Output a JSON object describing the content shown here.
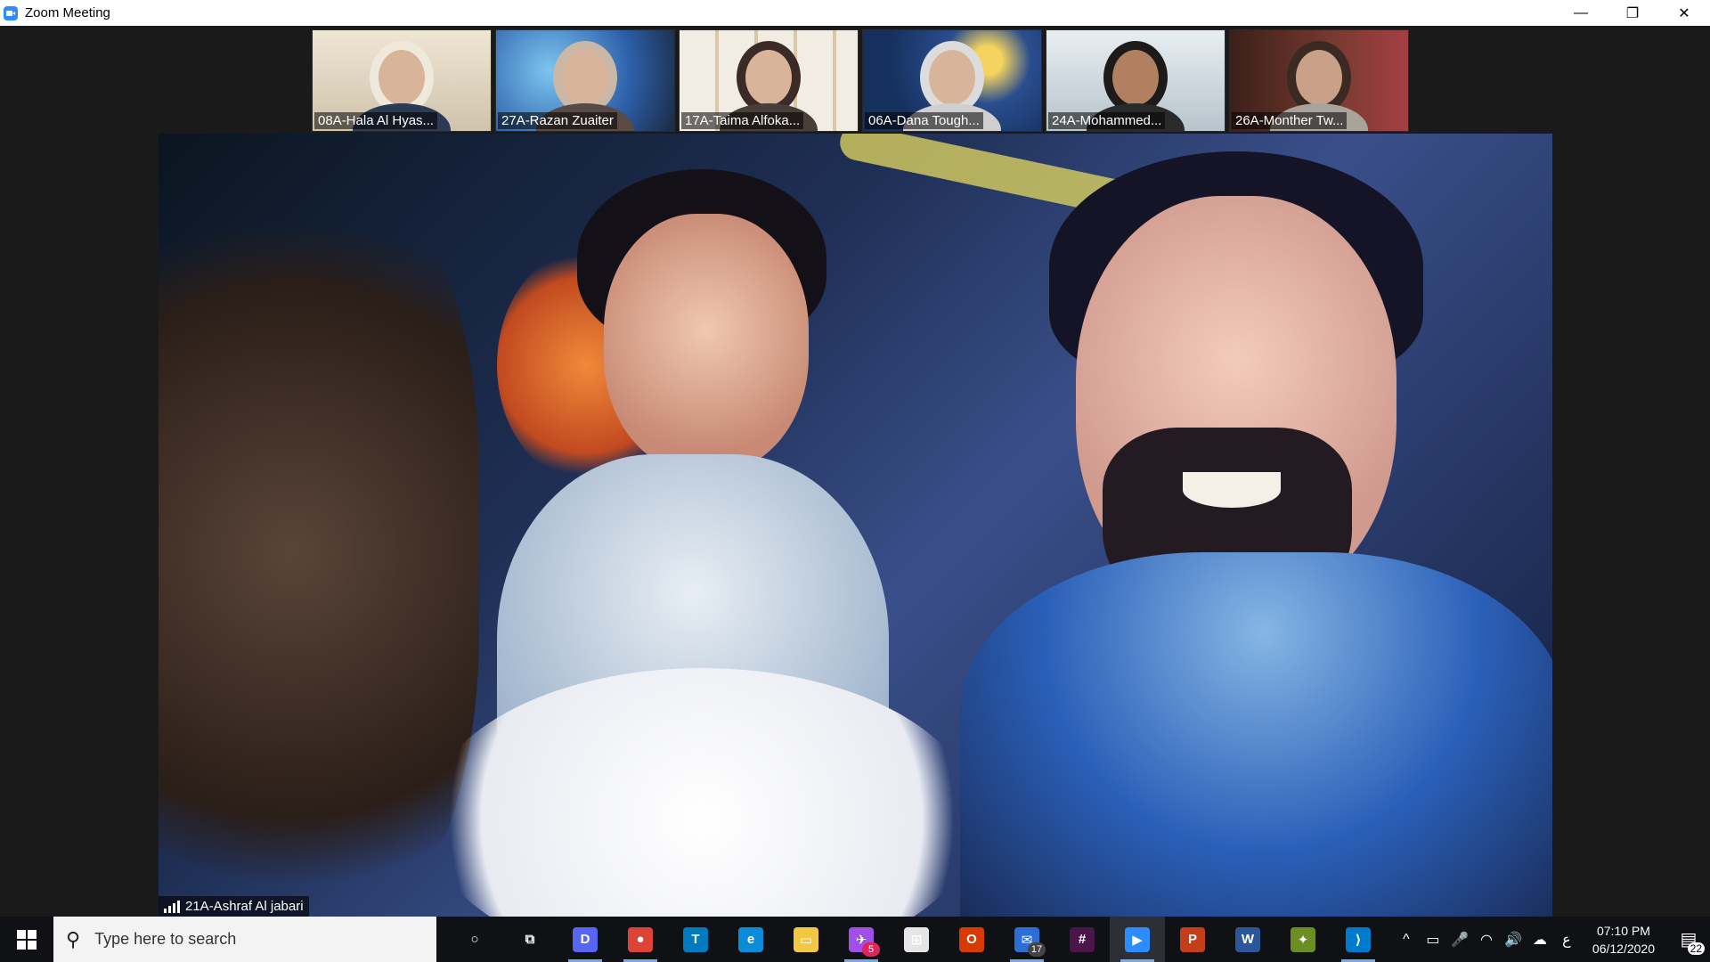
{
  "window": {
    "title": "Zoom Meeting",
    "minimize": "—",
    "restore": "❐",
    "close": "✕"
  },
  "participants": [
    {
      "name": "08A-Hala Al Hyas...",
      "bg": "#e7dcc8",
      "scarf": "#efe9dc",
      "body": "#2b3a55"
    },
    {
      "name": "27A-Razan Zuaiter",
      "bg": "#3d6fb8",
      "scarf": "#c9b8a6",
      "body": "#5a4a46"
    },
    {
      "name": "17A-Taima Alfoka...",
      "bg": "#f0ece2",
      "scarf": "#3b2a26",
      "body": "#4a3e3a"
    },
    {
      "name": "06A-Dana Tough...",
      "bg": "#21437c",
      "scarf": "#dcdcdc",
      "body": "#cfcfcf"
    },
    {
      "name": "24A-Mohammed...",
      "bg": "#dfe6ea",
      "scarf": "#1d1a1a",
      "body": "#2a2a2a"
    },
    {
      "name": "26A-Monther Tw...",
      "bg": "#4a2a22",
      "scarf": "#3a2a22",
      "body": "#a8a39b"
    }
  ],
  "active_speaker": {
    "name": "21A-Ashraf Al jabari"
  },
  "taskbar": {
    "search_placeholder": "Type here to search",
    "apps": [
      {
        "id": "cortana",
        "icon": "cortana-icon",
        "glyph": "○",
        "color": "transparent"
      },
      {
        "id": "task-view",
        "icon": "task-view-icon",
        "glyph": "⧉",
        "color": "transparent"
      },
      {
        "id": "discord",
        "icon": "discord-icon",
        "glyph": "D",
        "color": "#5865F2"
      },
      {
        "id": "chrome",
        "icon": "chrome-icon",
        "glyph": "●",
        "color": "#db4437"
      },
      {
        "id": "trello",
        "icon": "trello-icon",
        "glyph": "T",
        "color": "#0079BF"
      },
      {
        "id": "edge",
        "icon": "edge-icon",
        "glyph": "e",
        "color": "#0c8bd6"
      },
      {
        "id": "file-explorer",
        "icon": "folder-icon",
        "glyph": "▭",
        "color": "#f2c744"
      },
      {
        "id": "messenger",
        "icon": "messenger-icon",
        "glyph": "✈",
        "color": "#a050e8",
        "badge": "5"
      },
      {
        "id": "store",
        "icon": "store-icon",
        "glyph": "⊞",
        "color": "#e5e5e5"
      },
      {
        "id": "office",
        "icon": "office-icon",
        "glyph": "O",
        "color": "#d83b01"
      },
      {
        "id": "mail",
        "icon": "mail-icon",
        "glyph": "✉",
        "color": "#2b6fd6",
        "badge": "17"
      },
      {
        "id": "slack",
        "icon": "slack-icon",
        "glyph": "#",
        "color": "#4a154b"
      },
      {
        "id": "zoom",
        "icon": "zoom-icon",
        "glyph": "▶",
        "color": "#2D8CFF"
      },
      {
        "id": "powerpoint",
        "icon": "powerpoint-icon",
        "glyph": "P",
        "color": "#c43e1c"
      },
      {
        "id": "word",
        "icon": "word-icon",
        "glyph": "W",
        "color": "#2b579a"
      },
      {
        "id": "unknown-app",
        "icon": "app-icon",
        "glyph": "✦",
        "color": "#6b8e23"
      },
      {
        "id": "vscode",
        "icon": "vscode-icon",
        "glyph": "⟩",
        "color": "#007ACC"
      }
    ],
    "tray": {
      "chevron": "^",
      "battery": "▭",
      "mic": "🎤",
      "wifi": "◠",
      "volume": "🔊",
      "cloud": "☁",
      "lang": "ع"
    },
    "time": "07:10 PM",
    "date": "06/12/2020",
    "notifications": "22"
  }
}
